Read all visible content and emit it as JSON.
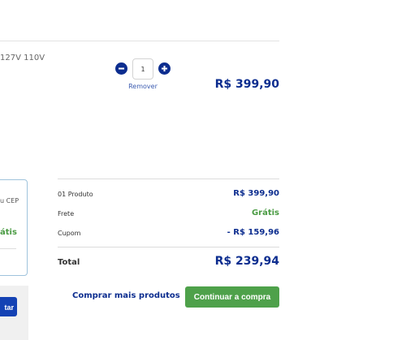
{
  "product": {
    "description_fragment": "127V 110V",
    "quantity": "1",
    "remove_label": "Remover",
    "price": "R$ 399,90"
  },
  "shipping_box": {
    "text_fragment": "u CEP",
    "free_fragment": "átis",
    "button_fragment": "tar"
  },
  "summary": {
    "rows": [
      {
        "label": "01 Produto",
        "value": "R$ 399,90"
      },
      {
        "label": "Frete",
        "value": "Grátis"
      },
      {
        "label": "Cupom",
        "value": "- R$ 159,96"
      }
    ],
    "total_label": "Total",
    "total_value": "R$ 239,94"
  },
  "actions": {
    "more_products": "Comprar mais produtos",
    "continue": "Continuar a compra"
  },
  "colors": {
    "brand_blue": "#0c2d8f",
    "success_green": "#4ea14a",
    "border_blue": "#9fc3dc"
  },
  "icons": {
    "decrease": "minus-circle-icon",
    "increase": "plus-circle-icon"
  }
}
